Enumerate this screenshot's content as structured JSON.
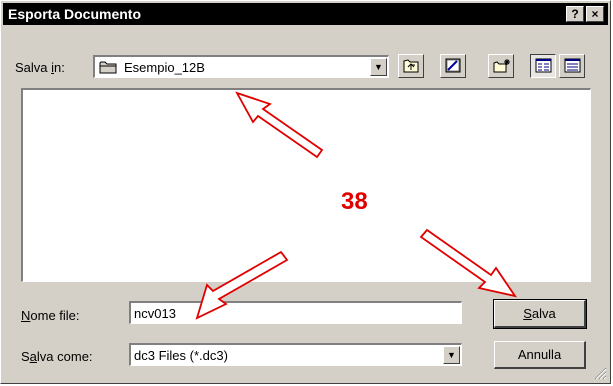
{
  "dialog": {
    "title": "Esporta Documento",
    "help_button": "?",
    "close_button": "×"
  },
  "save_in": {
    "label_prefix": "Salva ",
    "label_underline": "i",
    "label_suffix": "n:",
    "value": "Esempio_12B"
  },
  "toolbar": {
    "icons": [
      "up-folder-icon",
      "desktop-icon",
      "new-folder-icon",
      "list-view-icon",
      "details-view-icon"
    ]
  },
  "annotation": {
    "number": "38",
    "color": "#e00000"
  },
  "filename": {
    "label_underline": "N",
    "label_rest": "ome file:",
    "value": "ncv013"
  },
  "save_as": {
    "label_prefix": "S",
    "label_underline": "a",
    "label_rest": "lva come:",
    "value": "dc3 Files (*.dc3)"
  },
  "buttons": {
    "save_underline": "S",
    "save_rest": "alva",
    "cancel": "Annulla"
  }
}
